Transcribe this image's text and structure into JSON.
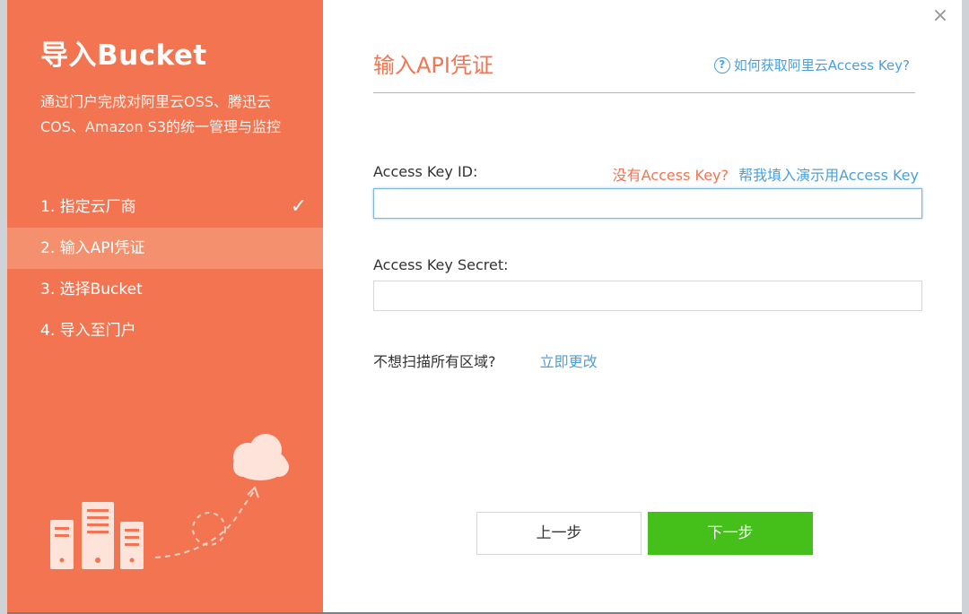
{
  "sidebar": {
    "title": "导入Bucket",
    "description": "通过门户完成对阿里云OSS、腾迅云COS、Amazon S3的统一管理与监控",
    "steps": [
      {
        "label": "1. 指定云厂商",
        "done": true
      },
      {
        "label": "2. 输入API凭证",
        "active": true
      },
      {
        "label": "3. 选择Bucket"
      },
      {
        "label": "4. 导入至门户"
      }
    ],
    "check_glyph": "✓"
  },
  "main": {
    "heading": "输入API凭证",
    "help_link": "如何获取阿里云Access Key?",
    "help_icon": "?",
    "access_key_id_label": "Access Key ID:",
    "no_key_text": "没有Access Key?",
    "fill_demo_link": "帮我填入演示用Access Key",
    "access_key_id_value": "",
    "access_key_secret_label": "Access Key Secret:",
    "access_key_secret_value": "",
    "region_question": "不想扫描所有区域?",
    "region_change_link": "立即更改",
    "prev_button": "上一步",
    "next_button": "下一步",
    "close_glyph": "×"
  },
  "colors": {
    "accent": "#f37450",
    "link": "#4b9fdc",
    "primary_button": "#45c01a"
  },
  "icons": [
    "check-icon",
    "question-circle-icon",
    "close-icon",
    "cloud-icon",
    "server-icon"
  ]
}
